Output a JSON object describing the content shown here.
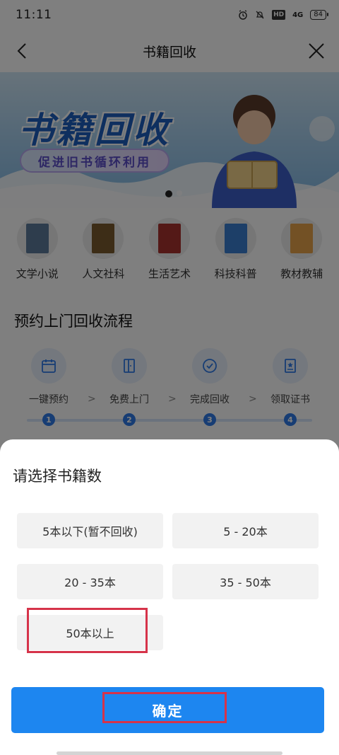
{
  "status_bar": {
    "time": "11:11",
    "icons": [
      "alarm-icon",
      "mute-bell-icon",
      "hd-icon",
      "4g-signal-icon",
      "battery-icon"
    ],
    "hd_label": "HD",
    "net_label": "4G",
    "battery": "84"
  },
  "nav": {
    "title": "书籍回收",
    "back_icon": "chevron-left-icon",
    "close_icon": "close-icon"
  },
  "banner": {
    "title": "书籍回收",
    "slogan": "促进旧书循环利用"
  },
  "categories": [
    {
      "label": "文学小说",
      "color": "#5c7a9a"
    },
    {
      "label": "人文社科",
      "color": "#7a5a2e"
    },
    {
      "label": "生活艺术",
      "color": "#a8322e"
    },
    {
      "label": "科技科普",
      "color": "#3a7fd0"
    },
    {
      "label": "教材教辅",
      "color": "#e6a34a"
    }
  ],
  "process": {
    "title": "预约上门回收流程",
    "steps": [
      {
        "label": "一键预约",
        "num": "1",
        "icon": "calendar-icon"
      },
      {
        "label": "免费上门",
        "num": "2",
        "icon": "door-icon"
      },
      {
        "label": "完成回收",
        "num": "3",
        "icon": "check-circle-icon"
      },
      {
        "label": "领取证书",
        "num": "4",
        "icon": "certificate-icon"
      }
    ],
    "arrow": ">"
  },
  "sheet": {
    "title": "请选择书籍数",
    "options": [
      "5本以下(暂不回收)",
      "5 - 20本",
      "20 - 35本",
      "35 - 50本",
      "50本以上"
    ],
    "confirm_label": "确定"
  },
  "colors": {
    "accent": "#1d86f0",
    "highlight": "#d6334a",
    "step_number": "#2f7be9"
  }
}
